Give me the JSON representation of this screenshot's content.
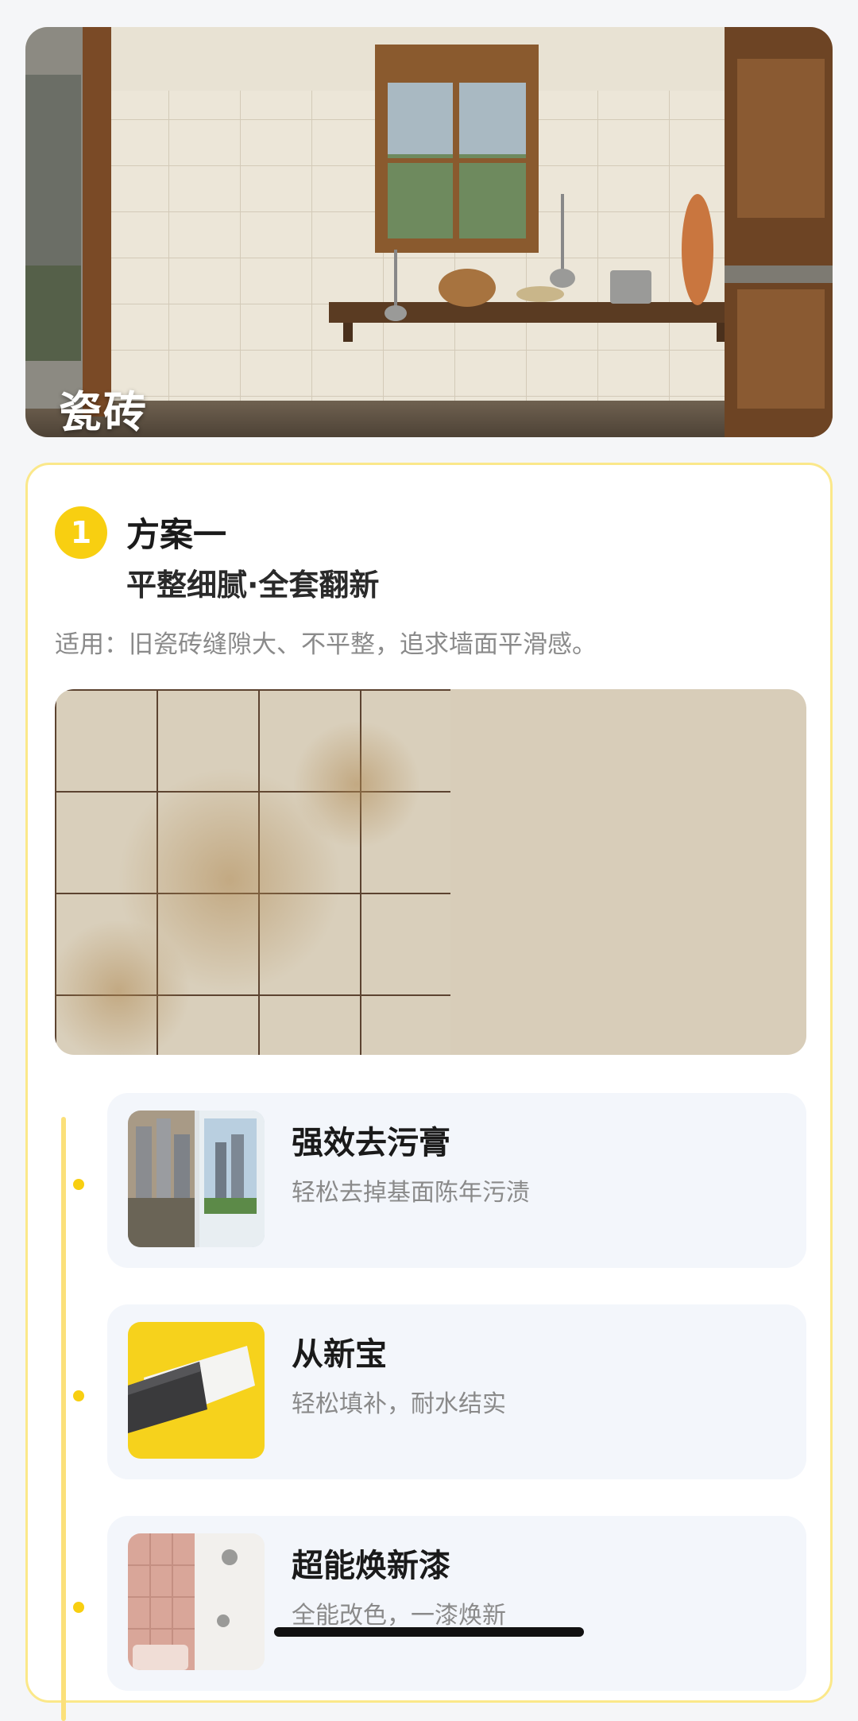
{
  "hero": {
    "title": "瓷砖",
    "image": "kitchen-tile-wall-photo"
  },
  "plan": {
    "number": "1",
    "title": "方案一",
    "subtitle": "平整细腻·全套翻新",
    "description": "适用：旧瓷砖缝隙大、不平整，追求墙面平滑感。",
    "compare_image": "old-tile-vs-smooth-wall-photo"
  },
  "steps": [
    {
      "title": "强效去污膏",
      "description": "轻松去掉基面陈年污渍",
      "image": "window-cleaning-photo"
    },
    {
      "title": "从新宝",
      "description": "轻松填补，耐水结实",
      "image": "putty-knife-photo"
    },
    {
      "title": "超能焕新漆",
      "description": "全能改色，一漆焕新",
      "image": "pink-bathroom-photo"
    }
  ],
  "colors": {
    "accent": "#f8cf11",
    "card_border": "#fbe88a",
    "step_bg": "#f3f6fb"
  }
}
